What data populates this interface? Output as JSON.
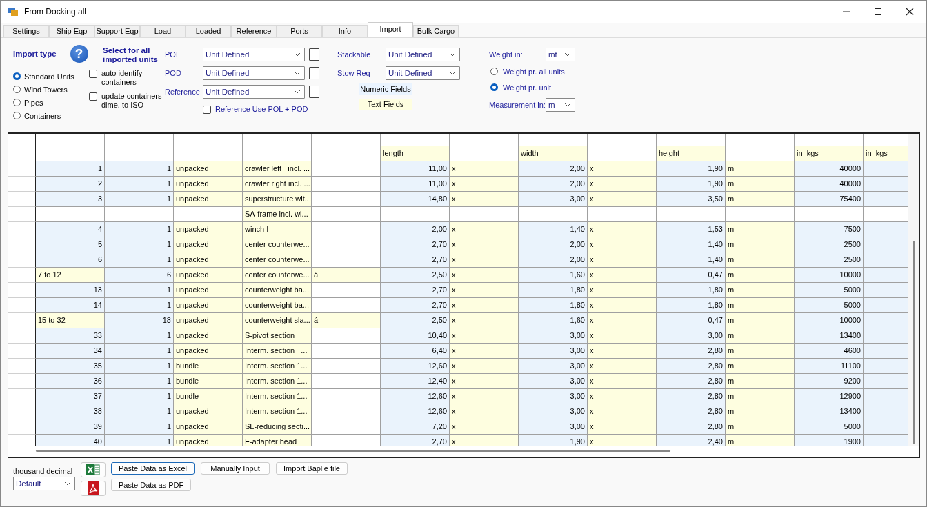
{
  "window": {
    "title": "From Docking all"
  },
  "tabs": [
    {
      "label": "Settings",
      "selected": false
    },
    {
      "label": "Ship Eqp",
      "selected": false
    },
    {
      "label": "Support Eqp",
      "selected": false
    },
    {
      "label": "Load",
      "selected": false
    },
    {
      "label": "Loaded",
      "selected": false
    },
    {
      "label": "Reference",
      "selected": false
    },
    {
      "label": "Ports",
      "selected": false
    },
    {
      "label": "Info",
      "selected": false
    },
    {
      "label": "Import",
      "selected": true
    },
    {
      "label": "Bulk Cargo",
      "selected": false
    }
  ],
  "import_type": {
    "title": "Import type",
    "help": "?",
    "options": [
      {
        "label": "Standard Units",
        "selected": true
      },
      {
        "label": "Wind Towers",
        "selected": false
      },
      {
        "label": "Pipes",
        "selected": false
      },
      {
        "label": "Containers",
        "selected": false
      }
    ]
  },
  "select_all": {
    "title": "Select for all imported units",
    "options": [
      {
        "label": "auto identify containers",
        "checked": false
      },
      {
        "label": "update containers dime. to ISO",
        "checked": false
      }
    ]
  },
  "port_fields": [
    {
      "label": "POL",
      "value": "Unit Defined",
      "checked": false
    },
    {
      "label": "POD",
      "value": "Unit Defined",
      "checked": false
    },
    {
      "label": "Reference",
      "value": "Unit Defined",
      "checked": false
    }
  ],
  "reference_use": {
    "label": "Reference Use POL + POD",
    "checked": false
  },
  "stow_fields": [
    {
      "label": "Stackable",
      "value": "Unit Defined"
    },
    {
      "label": "Stow Req",
      "value": "Unit Defined"
    }
  ],
  "legend": [
    {
      "label": "Numeric Fields",
      "kind": "numeric"
    },
    {
      "label": "Text Fields",
      "kind": "text"
    }
  ],
  "weight": {
    "label": "Weight in:",
    "value": "mt",
    "options": [
      {
        "label": "Weight pr. all units",
        "selected": false
      },
      {
        "label": "Weight pr. unit",
        "selected": true
      }
    ]
  },
  "measurement": {
    "label": "Measurement in:",
    "value": "m"
  },
  "grid": {
    "columns": [
      "",
      "",
      "",
      "",
      "",
      "length",
      "",
      "width",
      "",
      "height",
      "",
      "in  kgs",
      "in  kgs"
    ],
    "rows": [
      {
        "kind": "unit",
        "cells": [
          "1",
          "1",
          "unpacked",
          "crawler left   incl. ...",
          "",
          "11,00",
          "x",
          "2,00",
          "x",
          "1,90",
          "m",
          "40000",
          ""
        ]
      },
      {
        "kind": "unit",
        "cells": [
          "2",
          "1",
          "unpacked",
          "crawler right incl. ...",
          "",
          "11,00",
          "x",
          "2,00",
          "x",
          "1,90",
          "m",
          "40000",
          ""
        ]
      },
      {
        "kind": "unit",
        "cells": [
          "3",
          "1",
          "unpacked",
          "superstructure wit...",
          "",
          "14,80",
          "x",
          "3,00",
          "x",
          "3,50",
          "m",
          "75400",
          ""
        ]
      },
      {
        "kind": "note",
        "cells": [
          "",
          "",
          "",
          "SA-frame incl. wi...",
          "",
          "",
          "",
          "",
          "",
          "",
          "",
          "",
          ""
        ]
      },
      {
        "kind": "unit",
        "cells": [
          "4",
          "1",
          "unpacked",
          "winch I",
          "",
          "2,00",
          "x",
          "1,40",
          "x",
          "1,53",
          "m",
          "7500",
          ""
        ]
      },
      {
        "kind": "unit",
        "cells": [
          "5",
          "1",
          "unpacked",
          "center counterwe...",
          "",
          "2,70",
          "x",
          "2,00",
          "x",
          "1,40",
          "m",
          "2500",
          ""
        ]
      },
      {
        "kind": "unit",
        "cells": [
          "6",
          "1",
          "unpacked",
          "center counterwe...",
          "",
          "2,70",
          "x",
          "2,00",
          "x",
          "1,40",
          "m",
          "2500",
          ""
        ]
      },
      {
        "kind": "range",
        "cells": [
          "7 to 12",
          "6",
          "unpacked",
          "center counterwe...",
          "á",
          "2,50",
          "x",
          "1,60",
          "x",
          "0,47",
          "m",
          "10000",
          ""
        ]
      },
      {
        "kind": "unit",
        "cells": [
          "13",
          "1",
          "unpacked",
          "counterweight ba...",
          "",
          "2,70",
          "x",
          "1,80",
          "x",
          "1,80",
          "m",
          "5000",
          ""
        ]
      },
      {
        "kind": "unit",
        "cells": [
          "14",
          "1",
          "unpacked",
          "counterweight ba...",
          "",
          "2,70",
          "x",
          "1,80",
          "x",
          "1,80",
          "m",
          "5000",
          ""
        ]
      },
      {
        "kind": "range",
        "cells": [
          "15 to 32",
          "18",
          "unpacked",
          "counterweight sla...",
          "á",
          "2,50",
          "x",
          "1,60",
          "x",
          "0,47",
          "m",
          "10000",
          ""
        ]
      },
      {
        "kind": "unit",
        "cells": [
          "33",
          "1",
          "unpacked",
          "S-pivot section",
          "",
          "10,40",
          "x",
          "3,00",
          "x",
          "3,00",
          "m",
          "13400",
          ""
        ]
      },
      {
        "kind": "unit",
        "cells": [
          "34",
          "1",
          "unpacked",
          "Interm. section   ...",
          "",
          "6,40",
          "x",
          "3,00",
          "x",
          "2,80",
          "m",
          "4600",
          ""
        ]
      },
      {
        "kind": "unit",
        "cells": [
          "35",
          "1",
          "bundle",
          "Interm. section 1...",
          "",
          "12,60",
          "x",
          "3,00",
          "x",
          "2,80",
          "m",
          "11100",
          ""
        ]
      },
      {
        "kind": "unit",
        "cells": [
          "36",
          "1",
          "bundle",
          "Interm. section 1...",
          "",
          "12,40",
          "x",
          "3,00",
          "x",
          "2,80",
          "m",
          "9200",
          ""
        ]
      },
      {
        "kind": "unit",
        "cells": [
          "37",
          "1",
          "bundle",
          "Interm. section 1...",
          "",
          "12,60",
          "x",
          "3,00",
          "x",
          "2,80",
          "m",
          "12900",
          ""
        ]
      },
      {
        "kind": "unit",
        "cells": [
          "38",
          "1",
          "unpacked",
          "Interm. section 1...",
          "",
          "12,60",
          "x",
          "3,00",
          "x",
          "2,80",
          "m",
          "13400",
          ""
        ]
      },
      {
        "kind": "unit",
        "cells": [
          "39",
          "1",
          "unpacked",
          "SL-reducing secti...",
          "",
          "7,20",
          "x",
          "3,00",
          "x",
          "2,80",
          "m",
          "5000",
          ""
        ]
      },
      {
        "kind": "unit",
        "cells": [
          "40",
          "1",
          "unpacked",
          "F-adapter head",
          "",
          "2,70",
          "x",
          "1,90",
          "x",
          "2,40",
          "m",
          "1900",
          ""
        ]
      }
    ]
  },
  "thousand_decimal": {
    "label": "thousand decimal",
    "value": "Default"
  },
  "buttons": [
    {
      "label": "Paste Data as Excel",
      "kind": "excel",
      "focused": true
    },
    {
      "label": "Manually Input",
      "kind": "plain",
      "focused": false
    },
    {
      "label": "Import Baplie file",
      "kind": "plain",
      "focused": false
    },
    {
      "label": "Paste Data as PDF",
      "kind": "pdf",
      "focused": false
    }
  ]
}
